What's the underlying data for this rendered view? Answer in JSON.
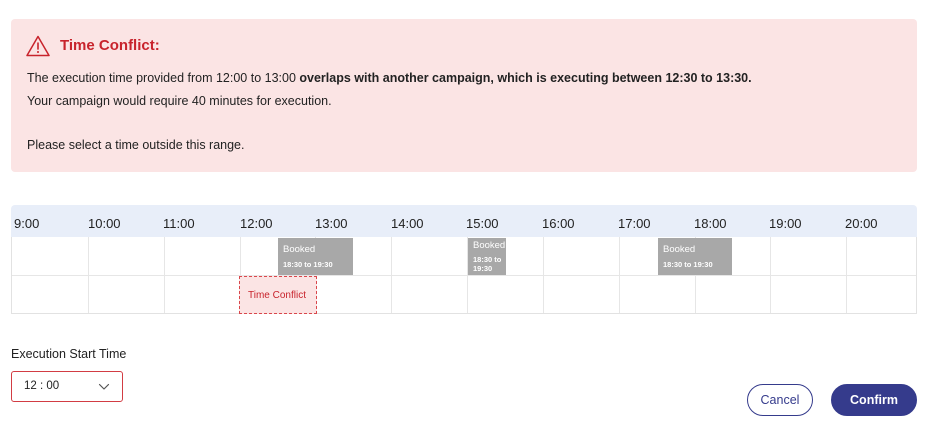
{
  "alert": {
    "icon": "warning-icon",
    "title": "Time Conflict:",
    "line1_prefix": "The execution time provided from 12:00 to 13:00 ",
    "line1_bold": "overlaps with another campaign, which is executing between 12:30 to 13:30.",
    "line2": "Your campaign would require 40 minutes for execution.",
    "line3": "Please select a time outside this range.",
    "colors": {
      "background": "#fbe4e4",
      "title": "#c8232c"
    }
  },
  "timeline": {
    "hours": [
      "9:00",
      "10:00",
      "11:00",
      "12:00",
      "13:00",
      "14:00",
      "15:00",
      "16:00",
      "17:00",
      "18:00",
      "19:00",
      "20:00"
    ],
    "booked": [
      {
        "label": "Booked",
        "time": "18:30 to 19:30"
      },
      {
        "label": "Booked",
        "time": "18:30 to 19:30"
      },
      {
        "label": "Booked",
        "time": "18:30 to 19:30"
      }
    ],
    "conflict_label": "Time Conflict"
  },
  "form": {
    "exec_label": "Execution Start Time",
    "selected_time": "12 : 00",
    "chevron_icon": "chevron-down-icon"
  },
  "buttons": {
    "cancel": "Cancel",
    "confirm": "Confirm",
    "accent": "#353b8c"
  }
}
